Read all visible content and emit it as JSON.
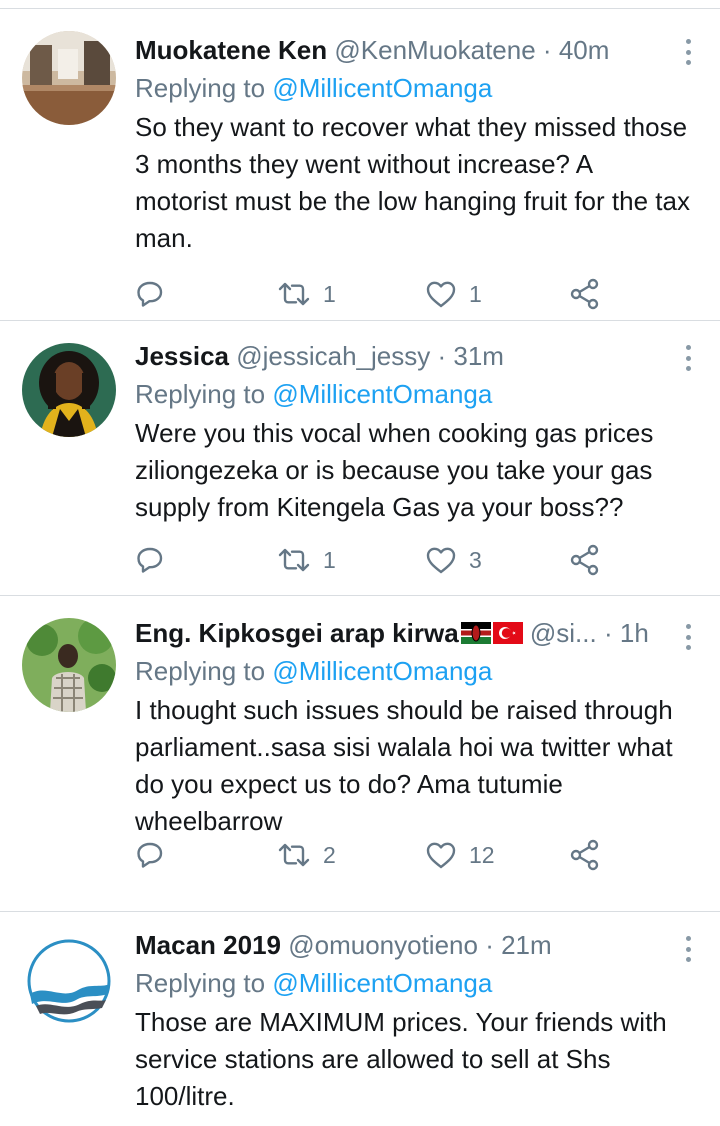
{
  "tweets": [
    {
      "name": "Muokatene Ken",
      "handle": "@KenMuokatene",
      "separator": "·",
      "time": "40m",
      "replying_prefix": "Replying to",
      "replying_to": "@MillicentOmanga",
      "body": "So they want to recover what they missed those 3 months they went without increase? A motorist must be the low hanging fruit for the tax man.",
      "retweets": "1",
      "likes": "1"
    },
    {
      "name": "Jessica",
      "handle": "@jessicah_jessy",
      "separator": "·",
      "time": "31m",
      "replying_prefix": "Replying to",
      "replying_to": "@MillicentOmanga",
      "body": "Were you this vocal when cooking gas prices ziliongezeka or is because you take your gas supply from Kitengela Gas ya your boss??",
      "retweets": "1",
      "likes": "3"
    },
    {
      "name": "Eng. Kipkosgei arap kirwa",
      "handle": "@si...",
      "separator": "·",
      "time": "1h",
      "replying_prefix": "Replying to",
      "replying_to": "@MillicentOmanga",
      "body": "I thought such issues should be raised through parliament..sasa sisi walala hoi wa twitter what do you expect us to do? Ama tutumie wheelbarrow",
      "retweets": "2",
      "likes": "12"
    },
    {
      "name": "Macan 2019",
      "handle": "@omuonyotieno",
      "separator": "·",
      "time": "21m",
      "replying_prefix": "Replying to",
      "replying_to": "@MillicentOmanga",
      "body": "Those are MAXIMUM prices. Your friends with service stations are allowed to sell at Shs 100/litre."
    }
  ],
  "colors": {
    "link": "#1da1f2",
    "muted": "#657786",
    "text": "#14171a",
    "divider": "#d9dde1"
  },
  "icons": [
    "reply-icon",
    "retweet-icon",
    "like-icon",
    "share-icon",
    "more-options-icon",
    "kenya-flag-icon",
    "turkey-flag-icon"
  ]
}
